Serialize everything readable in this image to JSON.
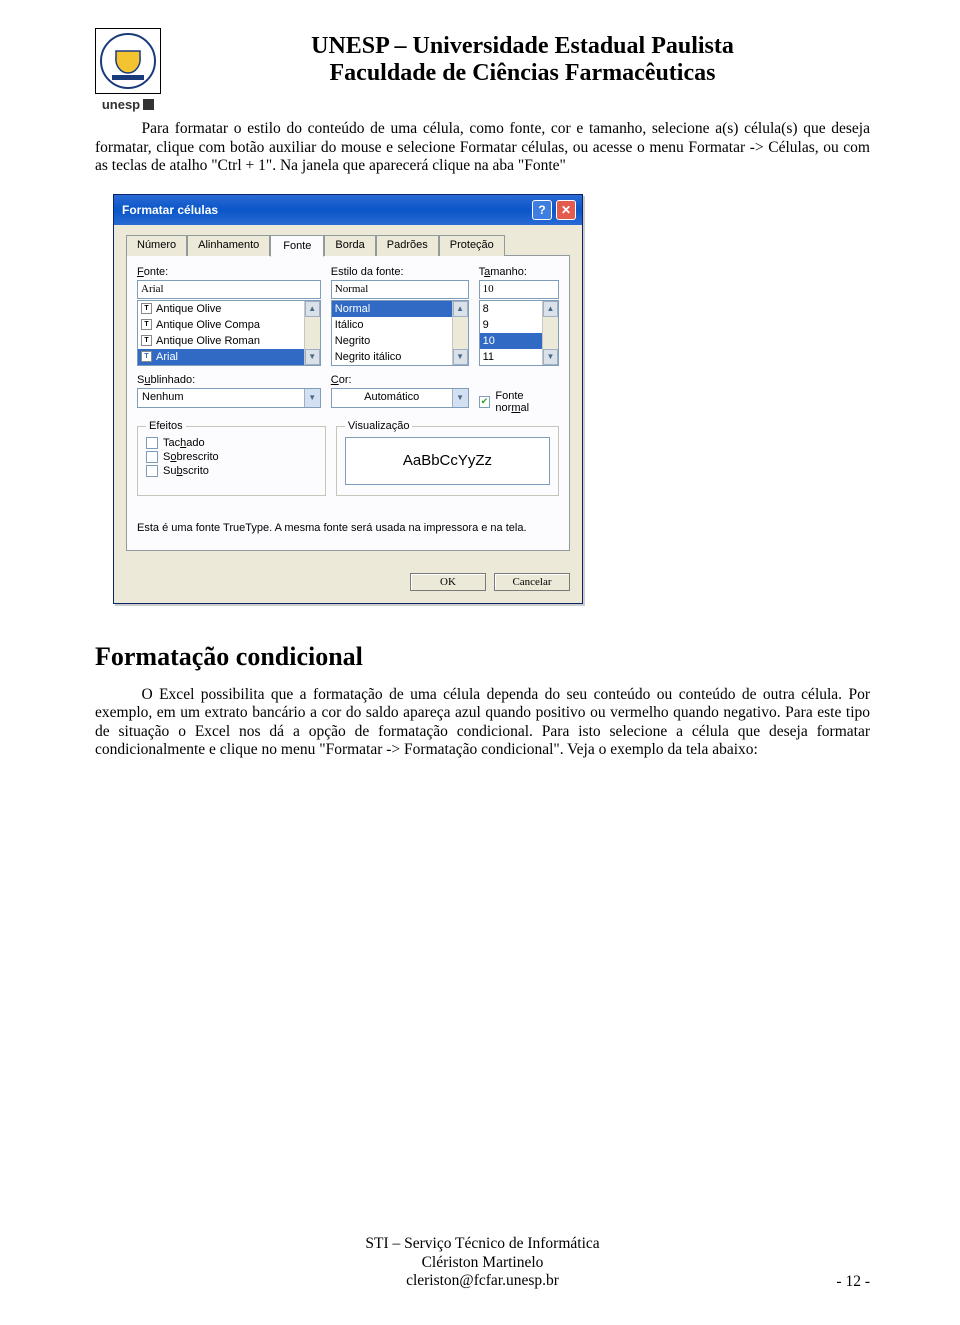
{
  "header": {
    "line1": "UNESP – Universidade Estadual Paulista",
    "line2": "Faculdade de Ciências Farmacêuticas",
    "logo_word": "unesp"
  },
  "paragraph1": "Para formatar o estilo do conteúdo de uma célula, como fonte, cor e tamanho, selecione a(s) célula(s) que deseja formatar, clique com botão auxiliar do mouse e selecione Formatar células, ou acesse o menu Formatar -> Células, ou com as teclas de atalho \"Ctrl + 1\". Na janela que aparecerá clique na aba \"Fonte\"",
  "dialog": {
    "title": "Formatar células",
    "tabs": [
      "Número",
      "Alinhamento",
      "Fonte",
      "Borda",
      "Padrões",
      "Proteção"
    ],
    "active_tab": "Fonte",
    "labels": {
      "fonte": "Fonte:",
      "estilo": "Estilo da fonte:",
      "tamanho": "Tamanho:",
      "sublinhado": "Sublinhado:",
      "cor": "Cor:",
      "efeitos": "Efeitos",
      "visualizacao": "Visualização"
    },
    "fonte_value": "Arial",
    "fonte_items": [
      "Antique Olive",
      "Antique Olive Compa",
      "Antique Olive Roman",
      "Arial"
    ],
    "estilo_value": "Normal",
    "estilo_items": [
      "Normal",
      "Itálico",
      "Negrito",
      "Negrito itálico"
    ],
    "tamanho_value": "10",
    "tamanho_items": [
      "8",
      "9",
      "10",
      "11"
    ],
    "sublinhado_value": "Nenhum",
    "cor_value": "Automático",
    "fonte_normal_label": "Fonte normal",
    "efeitos": {
      "tachado": "Tachado",
      "sobrescrito": "Sobrescrito",
      "subscrito": "Subscrito"
    },
    "preview_text": "AaBbCcYyZz",
    "hint": "Esta é uma fonte TrueType. A mesma fonte será usada na impressora e na tela.",
    "ok": "OK",
    "cancel": "Cancelar"
  },
  "section2_title": "Formatação condicional",
  "paragraph2": "O Excel possibilita que a formatação de uma célula dependa do seu conteúdo ou conteúdo de outra célula. Por exemplo, em um extrato bancário a cor do saldo apareça azul quando positivo ou vermelho quando negativo. Para este tipo de situação o Excel nos dá a opção de formatação condicional. Para isto selecione a célula que deseja formatar condicionalmente e clique no menu \"Formatar -> Formatação condicional\". Veja o exemplo da tela abaixo:",
  "footer": {
    "l1": "STI – Serviço Técnico de Informática",
    "l2": "Clériston Martinelo",
    "l3": "cleriston@fcfar.unesp.br"
  },
  "page_number": "- 12 -"
}
